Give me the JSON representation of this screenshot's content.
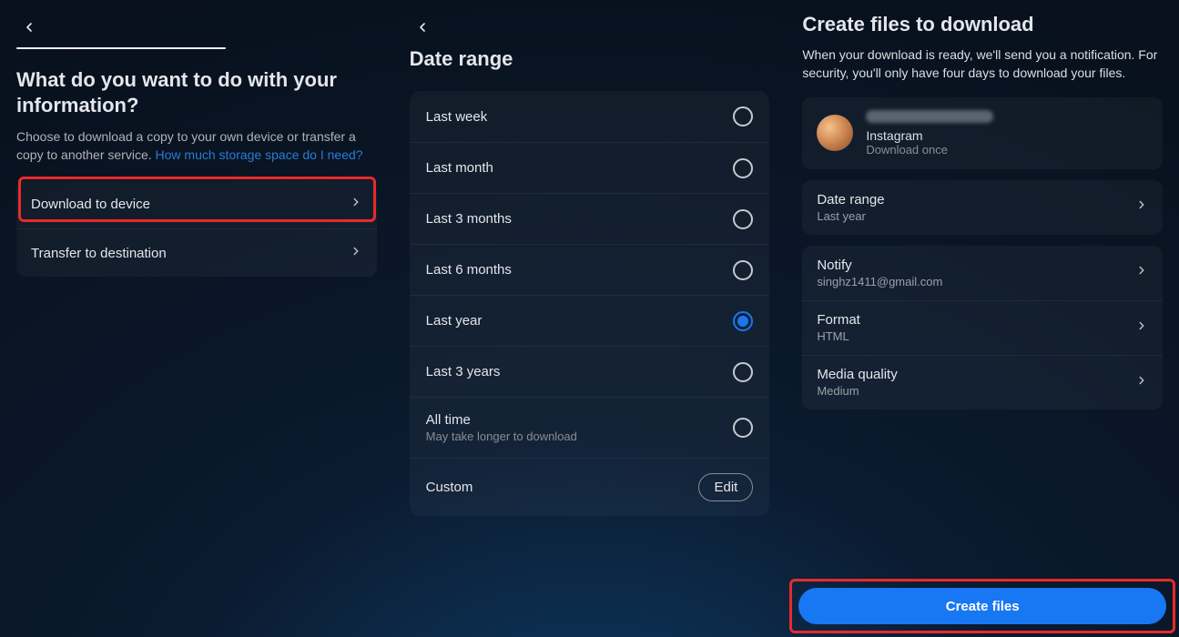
{
  "panel1": {
    "heading": "What do you want to do with your information?",
    "subtext": "Choose to download a copy to your own device or transfer a copy to another service. ",
    "link_text": "How much storage space do I need?",
    "options": {
      "download_to_device": "Download to device",
      "transfer_to_destination": "Transfer to destination"
    }
  },
  "panel2": {
    "heading": "Date range",
    "ranges": {
      "last_week": "Last week",
      "last_month": "Last month",
      "last_3_months": "Last 3 months",
      "last_6_months": "Last 6 months",
      "last_year": "Last year",
      "last_3_years": "Last 3 years",
      "all_time": "All time",
      "all_time_sub": "May take longer to download",
      "custom": "Custom"
    },
    "selected": "last_year",
    "edit_label": "Edit"
  },
  "panel3": {
    "heading": "Create files to download",
    "subtext": "When your download is ready, we'll send you a notification. For security, you'll only have four days to download your files.",
    "account": {
      "service": "Instagram",
      "sub": "Download once"
    },
    "settings": {
      "date_range": {
        "title": "Date range",
        "value": "Last year"
      },
      "notify": {
        "title": "Notify",
        "value": "singhz1411@gmail.com"
      },
      "format": {
        "title": "Format",
        "value": "HTML"
      },
      "media_quality": {
        "title": "Media quality",
        "value": "Medium"
      }
    },
    "create_button": "Create files"
  }
}
